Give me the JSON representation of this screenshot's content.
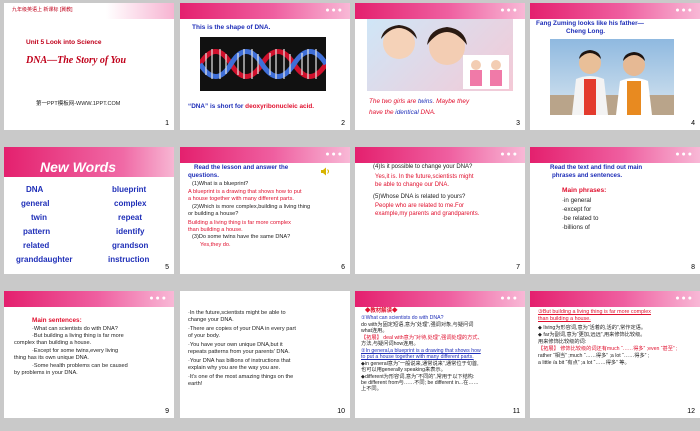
{
  "slides": [
    {
      "num": "1",
      "header": "九年级英语上    新课标 [冀教]",
      "unit": "Unit 5  Look into Science",
      "title": "DNA—The Story of You",
      "footer": "第一PPT模板网-WWW.1PPT.COM"
    },
    {
      "num": "2",
      "line1": "This is the shape of DNA.",
      "line2_a": "“DNA” is short for ",
      "line2_b": "deoxyribonucleic acid."
    },
    {
      "num": "3",
      "line1_a": "The two girls are ",
      "line1_b": "twins",
      "line1_c": ". Maybe they",
      "line2_a": "have the ",
      "line2_b": "identical",
      "line2_c": " DNA."
    },
    {
      "num": "4",
      "line1": "Fang Zuming looks like his father—",
      "line2": "Cheng Long."
    },
    {
      "num": "5",
      "title": "New Words",
      "left": [
        "DNA",
        "general",
        "twin",
        "pattern",
        "related",
        "granddaughter"
      ],
      "right": [
        "blueprint",
        "complex",
        "repeat",
        "identify",
        "grandson",
        "instruction"
      ]
    },
    {
      "num": "6",
      "intro1": "Read the lesson and answer the",
      "intro2": "questions.",
      "q1": "(1)What is a blueprint?",
      "a1_1": "A blueprint is a drawing that shows how to put",
      "a1_2": "a house together with many different parts.",
      "q2_1": "(2)Which is more complex,building a living thing",
      "q2_2": "or building a house?",
      "a2_1": "Building a living thing is far more complex",
      "a2_2": "than building a house.",
      "q3": "(3)Do some twins have the same DNA?",
      "a3": "Yes,they do."
    },
    {
      "num": "7",
      "q4": "(4)Is it possible to change your DNA?",
      "a4_1": "Yes,it is. In the future,scientists might",
      "a4_2": "be able to change our DNA.",
      "q5": "(5)Whose DNA is related to yours?",
      "a5_1": "People who are related to me.For",
      "a5_2": "example,my parents and grandparents."
    },
    {
      "num": "8",
      "intro1": "Read the text and find out main",
      "intro2": "phrases and sentences.",
      "heading": "Main phrases:",
      "items": [
        "·in general",
        "·except for",
        "·be related to",
        "·billions of"
      ]
    },
    {
      "num": "9",
      "heading": "Main sentences:",
      "lines": [
        "·What can scientists do with DNA?",
        "·But building a living thing is far more",
        "complex than building a house.",
        "·Except for some twins,every living",
        "thing has its own unique DNA.",
        "·Some health problems can be caused",
        "by problems in your DNA."
      ]
    },
    {
      "num": "10",
      "lines": [
        "·In the future,scientists might be able to",
        "change your DNA.",
        "·There are copies of your DNA in every part",
        "of your body.",
        "·You have your own unique DNA,but it",
        "repeats patterns from your parents' DNA.",
        "·Your DNA has billions of instructions that",
        "explain why you are the way you are.",
        "·It's one of the most amazing things on the",
        "earth!"
      ]
    },
    {
      "num": "11",
      "heading": "◆教材解读◆",
      "lines": [
        "①What can scientists do with DNA?",
        "do with为固定短语,意为“处理”,强调对象,与疑问词",
        "what连用。",
        "【拓展】 deal with意为“对待,处理”,强调处理的方式、",
        "方法,与疑问词how连用。",
        "②In general,a blueprint is a drawing that shows how",
        "to put a house together with many different parts.",
        "◆in general意为“一般说来,通常说来”,通常位于句首,",
        "也可以用generally speaking来表示。",
        "◆different为形容词,意为“不同的”,常用于以下结构:",
        "be different from与……不同; be different in...在……",
        "上不同。"
      ]
    },
    {
      "num": "12",
      "lines_red": [
        "③But building a living thing is far more complex",
        "than building a house."
      ],
      "lines": [
        "◆ living为形容词,意为“活着的,活的”,常作定语。",
        "◆ far为副词,意为“更加,远远”,用来修饰比较级。",
        "用来修饰比较级的词:",
        "【拓展】 修饰比较级的词还有much “……得多” ;even “甚至” ;",
        "rather “相当” ;much “……得多” ;a lot “……得多” ;",
        "a little /a bit “有点” ;a lot “……得多” 等。"
      ]
    }
  ]
}
